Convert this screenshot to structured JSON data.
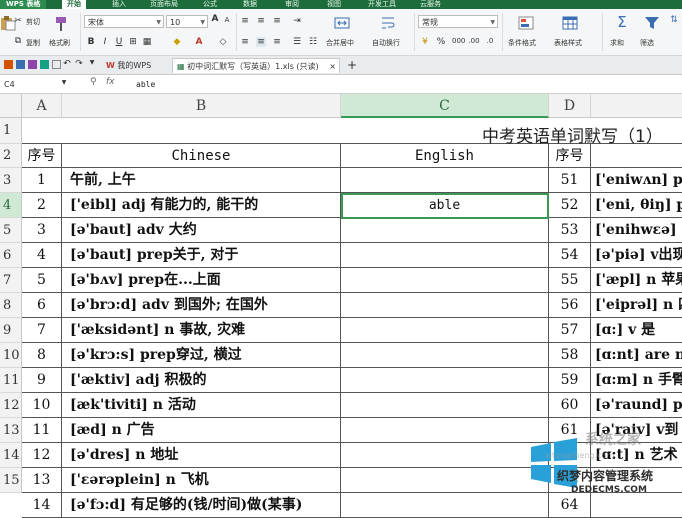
{
  "app": {
    "menu_label": "WPS 表格"
  },
  "ribbon_tabs": [
    "开始",
    "插入",
    "页面布局",
    "公式",
    "数据",
    "审阅",
    "视图",
    "开发工具",
    "云服务"
  ],
  "ribbon": {
    "cut": "剪切",
    "copy": "复制",
    "format_painter": "格式刷",
    "font_name": "宋体",
    "font_size": "10",
    "merge_center": "合并居中",
    "wrap_text": "自动换行",
    "number_format": "常规",
    "cond_format": "条件格式",
    "table_style": "表格样式",
    "sum": "求和",
    "filter": "筛选"
  },
  "doc_tabs": {
    "home": "我的WPS",
    "file": "初中词汇默写（写英语）1.xls (只读)"
  },
  "formula_bar": {
    "cell_ref": "C4",
    "fx_label": "fx",
    "value": "able"
  },
  "columns": [
    "A",
    "B",
    "C",
    "D"
  ],
  "sheet": {
    "title": "中考英语单词默写（1）",
    "headers": {
      "seq": "序号",
      "chinese": "Chinese",
      "english": "English",
      "seq2": "序号"
    },
    "row_numbers": [
      "1",
      "2",
      "3",
      "4",
      "5",
      "6",
      "7",
      "8",
      "9",
      "10",
      "11",
      "12",
      "13",
      "14",
      "15"
    ],
    "rows": [
      {
        "n": "1",
        "cn": "午前, 上午",
        "en": "",
        "n2": "51",
        "cn2": "['eniwʌn] p"
      },
      {
        "n": "2",
        "cn": "['eibl] adj 有能力的, 能干的",
        "en": "able",
        "n2": "52",
        "cn2": "['eni, θiŋ] p"
      },
      {
        "n": "3",
        "cn": "[ə'baut] adv 大约",
        "en": "",
        "n2": "53",
        "cn2": "['enihwɛə] a"
      },
      {
        "n": "4",
        "cn": "[ə'baut] prep关于, 对于",
        "en": "",
        "n2": "54",
        "cn2": "[ə'piə] v出现"
      },
      {
        "n": "5",
        "cn": "[ə'bʌv] prep在...上面",
        "en": "",
        "n2": "55",
        "cn2": "['æpl] n 苹果"
      },
      {
        "n": "6",
        "cn": "[ə'brɔ:d] adv 到国外; 在国外",
        "en": "",
        "n2": "56",
        "cn2": "['eiprəl] n 四"
      },
      {
        "n": "7",
        "cn": "['æksidənt] n 事故, 灾难",
        "en": "",
        "n2": "57",
        "cn2": "[ɑ:] v 是"
      },
      {
        "n": "8",
        "cn": "[ə'krɔ:s] prep穿过, 横过",
        "en": "",
        "n2": "58",
        "cn2": "[ɑ:nt] are n"
      },
      {
        "n": "9",
        "cn": "['æktiv] adj 积极的",
        "en": "",
        "n2": "59",
        "cn2": "[ɑ:m] n 手臂"
      },
      {
        "n": "10",
        "cn": "[æk'tiviti] n 活动",
        "en": "",
        "n2": "60",
        "cn2": "[ə'raund] pr"
      },
      {
        "n": "11",
        "cn": "[æd] n 广告",
        "en": "",
        "n2": "61",
        "cn2": "[ə'raiv] v到"
      },
      {
        "n": "12",
        "cn": "[ə'dres] n 地址",
        "en": "",
        "n2": "62",
        "cn2": "[ɑ:t] n 艺术"
      },
      {
        "n": "13",
        "cn": "['ɛərəplein] n 飞机",
        "en": "",
        "n2": "63",
        "cn2": ""
      },
      {
        "n": "14",
        "cn": "[ə'fɔ:d] 有足够的(钱/时间)做(某事)",
        "en": "",
        "n2": "64",
        "cn2": ""
      }
    ]
  },
  "watermark": {
    "line1": "系统之家",
    "line2": "xitongcheng.com",
    "line3": "织梦内容管理系统",
    "line4": "DEDECMS.COM"
  },
  "colors": {
    "accent": "#1d6d3c",
    "selection": "#3a9a55",
    "selection_header": "#cfe9d5"
  }
}
